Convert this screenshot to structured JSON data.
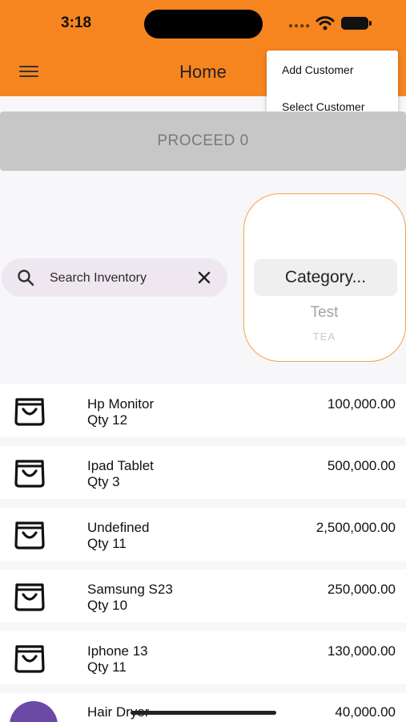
{
  "status_bar": {
    "time": "3:18"
  },
  "header": {
    "title": "Home",
    "menu_icon": "hamburger-icon"
  },
  "popup_menu": {
    "items": [
      "Add Customer",
      "Select Customer"
    ]
  },
  "proceed_button": {
    "label": "PROCEED 0"
  },
  "search": {
    "placeholder": "Search Inventory",
    "icon": "search-icon",
    "clear_icon": "close-icon"
  },
  "category": {
    "selected": "Category...",
    "options": [
      "Test",
      "TEA"
    ]
  },
  "inventory": [
    {
      "name": "Hp Monitor",
      "qty": "Qty 12",
      "price": "100,000.00",
      "icon": "shopping-bag-icon"
    },
    {
      "name": "Ipad Tablet",
      "qty": "Qty 3",
      "price": "500,000.00",
      "icon": "shopping-bag-icon"
    },
    {
      "name": "Undefined",
      "qty": "Qty 11",
      "price": "2,500,000.00",
      "icon": "shopping-bag-icon"
    },
    {
      "name": "Samsung S23",
      "qty": "Qty 10",
      "price": "250,000.00",
      "icon": "shopping-bag-icon"
    },
    {
      "name": "Iphone 13",
      "qty": "Qty 11",
      "price": "130,000.00",
      "icon": "shopping-bag-icon"
    },
    {
      "name": "Hair Dryer",
      "qty": "",
      "price": "40,000.00",
      "icon": "avatar"
    }
  ],
  "colors": {
    "accent": "#f6851f",
    "proceed_bg": "#c7c7c7",
    "search_bg": "#efe7f0",
    "category_border": "#f6a04d",
    "avatar": "#6b4aa5"
  }
}
